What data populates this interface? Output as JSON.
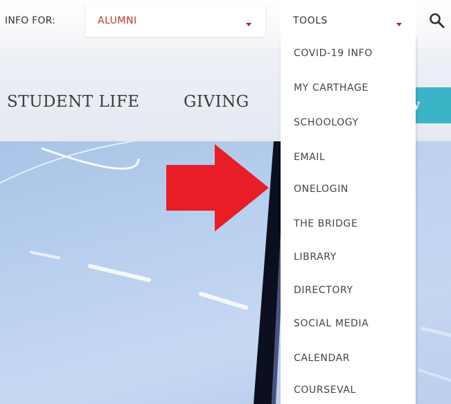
{
  "info_for": {
    "label": "INFO FOR:",
    "selected": "ALUMNI"
  },
  "tools": {
    "label": "TOOLS",
    "items": [
      "COVID-19 INFO",
      "MY CARTHAGE",
      "SCHOOLOGY",
      "EMAIL",
      "ONELOGIN",
      "THE BRIDGE",
      "LIBRARY",
      "DIRECTORY",
      "SOCIAL MEDIA",
      "CALENDAR",
      "COURSEVAL"
    ]
  },
  "main_nav": {
    "student_life": "STUDENT LIFE",
    "giving": "GIVING",
    "cta_partial": "ow"
  },
  "icons": {
    "search": "search-icon",
    "caret": "chevron-down-icon",
    "annotation": "red-arrow-icon"
  },
  "colors": {
    "accent_red": "#c0392b",
    "cta_teal": "#3cb4c8",
    "arrow_red": "#e81d25"
  }
}
